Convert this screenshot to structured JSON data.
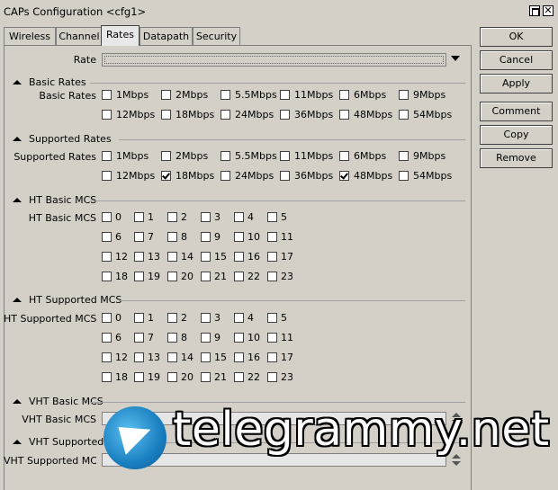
{
  "window": {
    "title": "CAPs Configuration <cfg1>",
    "close_glyph": "✕"
  },
  "tabs": [
    "Wireless",
    "Channel",
    "Rates",
    "Datapath",
    "Security"
  ],
  "active_tab": "Rates",
  "rate": {
    "label": "Rate",
    "value": ""
  },
  "basic_rates": {
    "title": "Basic Rates",
    "label": "Basic Rates",
    "options": [
      {
        "label": "1Mbps",
        "checked": false
      },
      {
        "label": "2Mbps",
        "checked": false
      },
      {
        "label": "5.5Mbps",
        "checked": false
      },
      {
        "label": "11Mbps",
        "checked": false
      },
      {
        "label": "6Mbps",
        "checked": false
      },
      {
        "label": "9Mbps",
        "checked": false
      },
      {
        "label": "12Mbps",
        "checked": false
      },
      {
        "label": "18Mbps",
        "checked": false
      },
      {
        "label": "24Mbps",
        "checked": false
      },
      {
        "label": "36Mbps",
        "checked": false
      },
      {
        "label": "48Mbps",
        "checked": false
      },
      {
        "label": "54Mbps",
        "checked": false
      }
    ]
  },
  "supported_rates": {
    "title": "Supported Rates",
    "label": "Supported Rates",
    "options": [
      {
        "label": "1Mbps",
        "checked": false
      },
      {
        "label": "2Mbps",
        "checked": false
      },
      {
        "label": "5.5Mbps",
        "checked": false
      },
      {
        "label": "11Mbps",
        "checked": false
      },
      {
        "label": "6Mbps",
        "checked": false
      },
      {
        "label": "9Mbps",
        "checked": false
      },
      {
        "label": "12Mbps",
        "checked": false
      },
      {
        "label": "18Mbps",
        "checked": true
      },
      {
        "label": "24Mbps",
        "checked": false
      },
      {
        "label": "36Mbps",
        "checked": false
      },
      {
        "label": "48Mbps",
        "checked": true
      },
      {
        "label": "54Mbps",
        "checked": false
      }
    ]
  },
  "ht_basic_mcs": {
    "title": "HT Basic MCS",
    "label": "HT Basic MCS",
    "options": [
      "0",
      "1",
      "2",
      "3",
      "4",
      "5",
      "6",
      "7",
      "8",
      "9",
      "10",
      "11",
      "12",
      "13",
      "14",
      "15",
      "16",
      "17",
      "18",
      "19",
      "20",
      "21",
      "22",
      "23"
    ],
    "checked": []
  },
  "ht_supported_mcs": {
    "title": "HT Supported MCS",
    "label": "HT Supported MCS",
    "options": [
      "0",
      "1",
      "2",
      "3",
      "4",
      "5",
      "6",
      "7",
      "8",
      "9",
      "10",
      "11",
      "12",
      "13",
      "14",
      "15",
      "16",
      "17",
      "18",
      "19",
      "20",
      "21",
      "22",
      "23"
    ],
    "checked": []
  },
  "vht_basic_mcs": {
    "title": "VHT Basic MCS",
    "label": "VHT Basic MCS",
    "value": ""
  },
  "vht_supported_mcs": {
    "title": "VHT Supported MCS",
    "label": "VHT Supported MCS",
    "value": ""
  },
  "buttons": {
    "ok": "OK",
    "cancel": "Cancel",
    "apply": "Apply",
    "comment": "Comment",
    "copy": "Copy",
    "remove": "Remove"
  },
  "watermark": {
    "text": "telegrammy.net",
    "icon": "telegram-plane-icon"
  }
}
